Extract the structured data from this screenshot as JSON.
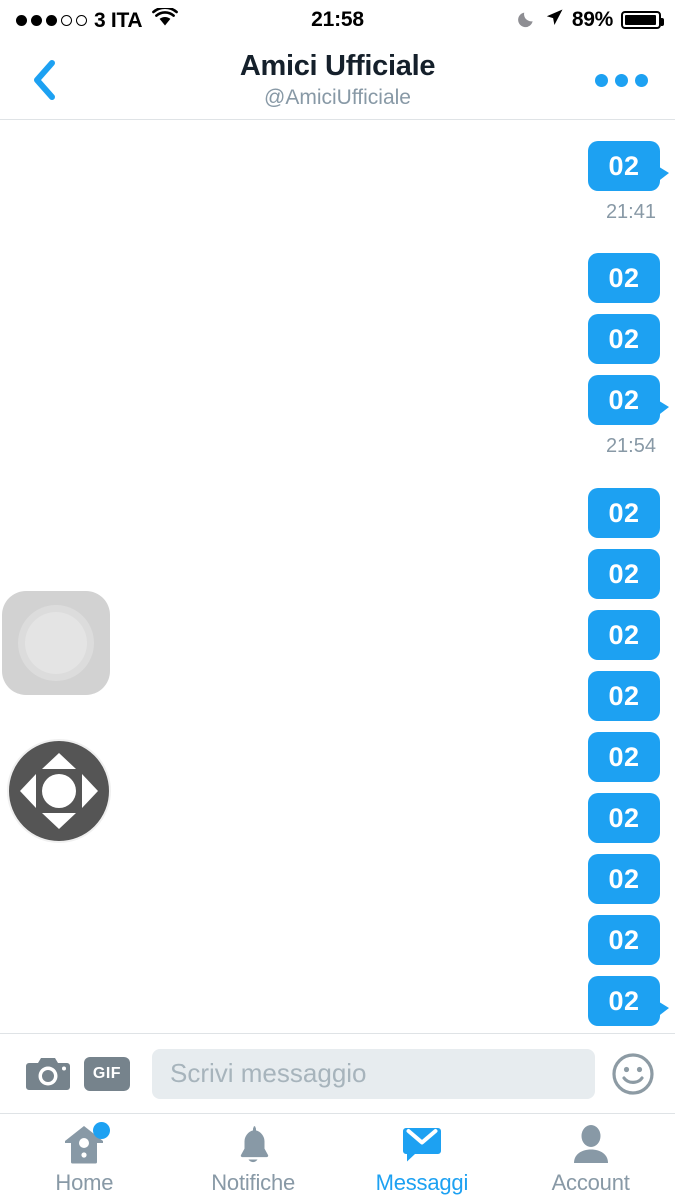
{
  "status_bar": {
    "signal_dots_filled": 3,
    "signal_dots_total": 5,
    "carrier": "3 ITA",
    "wifi_icon": "wifi-icon",
    "time": "21:58",
    "dnd_icon": "moon-icon",
    "location_icon": "location-arrow-icon",
    "battery_percent": "89%",
    "battery_level": 89
  },
  "nav": {
    "back_icon": "chevron-left-icon",
    "title": "Amici Ufficiale",
    "handle": "@AmiciUfficiale",
    "more_icon": "more-horizontal-icon"
  },
  "conversation": {
    "groups": [
      {
        "messages": [
          "02"
        ],
        "timestamp": "21:41"
      },
      {
        "messages": [
          "02",
          "02",
          "02"
        ],
        "timestamp": "21:54"
      },
      {
        "messages": [
          "02",
          "02",
          "02",
          "02",
          "02",
          "02",
          "02",
          "02",
          "02"
        ],
        "timestamp": ""
      }
    ],
    "bubble_color": "#1da1f2",
    "bubble_text_color": "#ffffff",
    "timestamp_color": "#8899a6"
  },
  "overlays": {
    "assistive_touch": {
      "name": "assistive-touch-button",
      "color": "#d2d2d2"
    },
    "dpad": {
      "name": "dpad-control",
      "color": "#555555",
      "directions": [
        "up",
        "right",
        "down",
        "left"
      ]
    }
  },
  "composer": {
    "camera_icon": "camera-icon",
    "gif_label": "GIF",
    "input_value": "",
    "input_placeholder": "Scrivi messaggio",
    "emoji_icon": "smiley-icon",
    "input_bg": "#e7ecef"
  },
  "tabbar": {
    "accent_color": "#1da1f2",
    "inactive_color": "#8899a6",
    "tabs": [
      {
        "label": "Home",
        "icon": "home-icon",
        "active": false,
        "badge": true
      },
      {
        "label": "Notifiche",
        "icon": "bell-icon",
        "active": false,
        "badge": false
      },
      {
        "label": "Messaggi",
        "icon": "envelope-icon",
        "active": true,
        "badge": false
      },
      {
        "label": "Account",
        "icon": "person-icon",
        "active": false,
        "badge": false
      }
    ]
  }
}
